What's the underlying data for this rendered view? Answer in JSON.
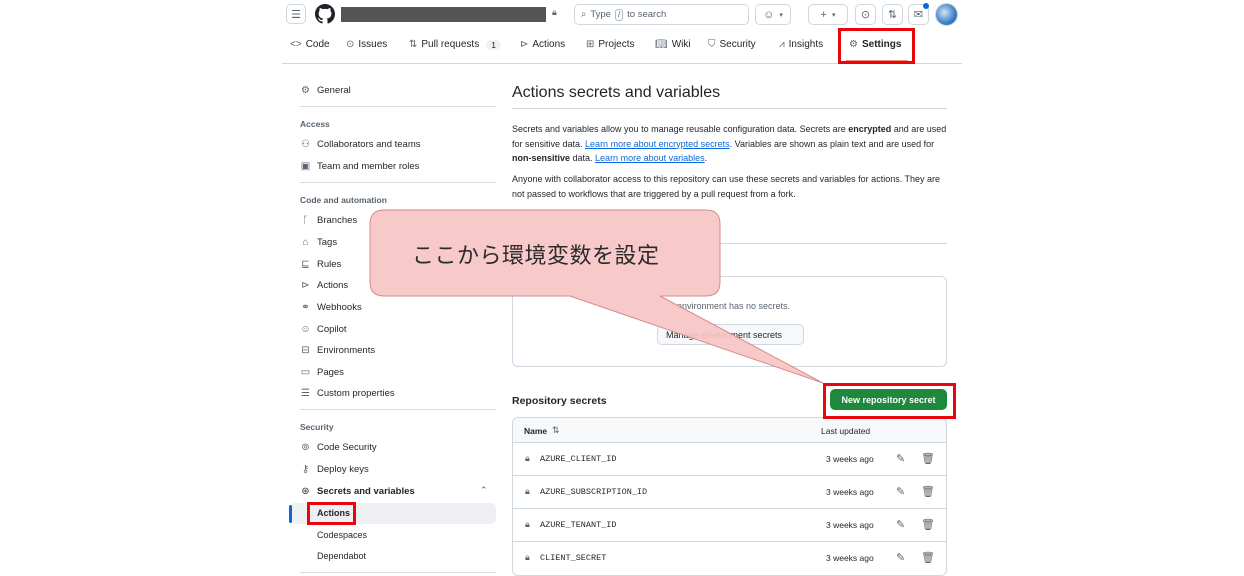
{
  "topbar": {
    "search_placeholder_pre": "Type",
    "search_key": "/",
    "search_placeholder_post": "to search",
    "plus_label": "+"
  },
  "repo_nav": {
    "items": [
      {
        "label": "Code",
        "icon": "code-icon"
      },
      {
        "label": "Issues",
        "icon": "issue-icon"
      },
      {
        "label": "Pull requests",
        "icon": "pull-request-icon",
        "count": "1"
      },
      {
        "label": "Actions",
        "icon": "play-icon"
      },
      {
        "label": "Projects",
        "icon": "table-icon"
      },
      {
        "label": "Wiki",
        "icon": "book-icon"
      },
      {
        "label": "Security",
        "icon": "shield-icon"
      },
      {
        "label": "Insights",
        "icon": "graph-icon"
      },
      {
        "label": "Settings",
        "icon": "gear-icon"
      }
    ]
  },
  "sidebar": {
    "general": "General",
    "access_heading": "Access",
    "collaborators": "Collaborators and teams",
    "team_roles": "Team and member roles",
    "code_heading": "Code and automation",
    "branches": "Branches",
    "tags": "Tags",
    "rules": "Rules",
    "actions": "Actions",
    "webhooks": "Webhooks",
    "copilot": "Copilot",
    "environments": "Environments",
    "pages": "Pages",
    "custom_props": "Custom properties",
    "security_heading": "Security",
    "code_security": "Code Security",
    "deploy_keys": "Deploy keys",
    "secrets_vars": "Secrets and variables",
    "sub_actions": "Actions",
    "sub_codespaces": "Codespaces",
    "sub_dependabot": "Dependabot"
  },
  "main": {
    "title": "Actions secrets and variables",
    "p1_a": "Secrets and variables allow you to manage reusable configuration data. Secrets are ",
    "p1_b": "encrypted",
    "p1_c": " and are used for sensitive data. ",
    "p1_link1": "Learn more about encrypted secrets",
    "p1_d": ". Variables are shown as plain text and are used for ",
    "p1_e": "non-sensitive",
    "p1_f": " data. ",
    "p1_link2": "Learn more about variables",
    "p1_g": ".",
    "p2": "Anyone with collaborator access to this repository can use these secrets and variables for actions. They are not passed to workflows that are triggered by a pull request from a fork.",
    "env_text": "environment has no secrets.",
    "env_button": "Manage environment secrets",
    "repo_secrets_title": "Repository secrets",
    "new_secret_button": "New repository secret",
    "col_name": "Name",
    "col_updated": "Last updated",
    "secrets": [
      {
        "name": "AZURE_CLIENT_ID",
        "updated": "3 weeks ago"
      },
      {
        "name": "AZURE_SUBSCRIPTION_ID",
        "updated": "3 weeks ago"
      },
      {
        "name": "AZURE_TENANT_ID",
        "updated": "3 weeks ago"
      },
      {
        "name": "CLIENT_SECRET",
        "updated": "3 weeks ago"
      }
    ]
  },
  "callout": {
    "text": "ここから環境変数を設定"
  },
  "colors": {
    "highlight": "#e8060c",
    "primary_button": "#1f883d",
    "link": "#0969da",
    "callout_fill": "#f6c5c5",
    "callout_stroke": "#d98a8a"
  }
}
